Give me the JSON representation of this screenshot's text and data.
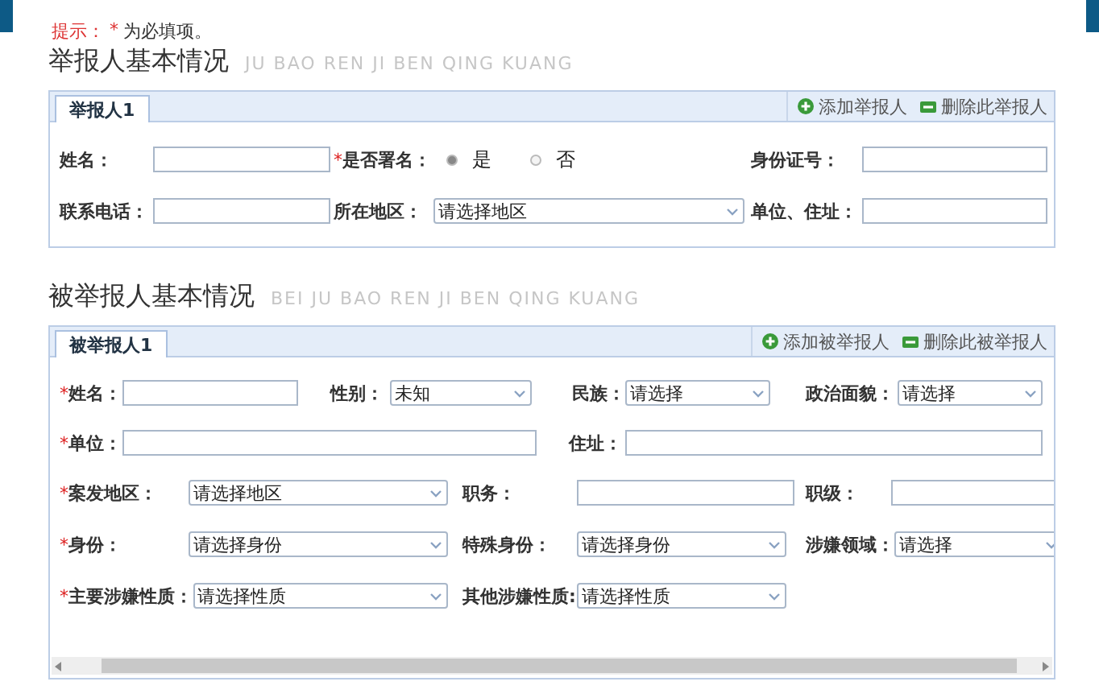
{
  "hint": {
    "label": "提示：",
    "mark": "*",
    "text": "为必填项。"
  },
  "sections": [
    {
      "title": "举报人基本情况",
      "pinyin": "JU BAO REN JI BEN QING KUANG",
      "tab": {
        "label": "举报人1",
        "selected": true
      },
      "actions": [
        {
          "kind": "add",
          "label": "添加举报人"
        },
        {
          "kind": "remove",
          "label": "删除此举报人"
        }
      ],
      "scrollbar": false,
      "field_lines": [
        [
          {
            "label": "姓名：",
            "required": false,
            "kind": "input"
          },
          {
            "label": "是否署名：",
            "required": true,
            "kind": "radio",
            "options": [
              {
                "label": "是",
                "selected": true
              },
              {
                "label": "否",
                "selected": false
              }
            ]
          },
          {
            "label": "身份证号：",
            "required": false,
            "kind": "input"
          }
        ],
        [
          {
            "label": "联系电话：",
            "required": false,
            "kind": "input"
          },
          {
            "label": "所在地区：",
            "required": false,
            "kind": "select",
            "value": "请选择地区"
          },
          {
            "label": "单位、住址：",
            "required": false,
            "kind": "input"
          }
        ]
      ]
    },
    {
      "title": "被举报人基本情况",
      "pinyin": "BEI JU BAO REN JI BEN QING KUANG",
      "tab": {
        "label": "被举报人1",
        "selected": true
      },
      "actions": [
        {
          "kind": "add",
          "label": "添加被举报人"
        },
        {
          "kind": "remove",
          "label": "删除此被举报人"
        }
      ],
      "scrollbar": true,
      "field_lines": [
        [
          {
            "label": "姓名：",
            "required": true,
            "kind": "input"
          },
          {
            "label": "性别：",
            "required": false,
            "kind": "select",
            "value": "未知"
          },
          {
            "label": "民族：",
            "required": false,
            "kind": "select",
            "value": "请选择"
          },
          {
            "label": "政治面貌：",
            "required": false,
            "kind": "select",
            "value": "请选择"
          }
        ],
        [
          {
            "label": "单位：",
            "required": true,
            "kind": "input"
          },
          {
            "label": "住址：",
            "required": false,
            "kind": "input"
          }
        ],
        [
          {
            "label": "案发地区：",
            "required": true,
            "kind": "select",
            "value": "请选择地区"
          },
          {
            "label": "职务：",
            "required": false,
            "kind": "input"
          },
          {
            "label": "职级：",
            "required": false,
            "kind": "input"
          }
        ],
        [
          {
            "label": "身份：",
            "required": true,
            "kind": "select",
            "value": "请选择身份"
          },
          {
            "label": "特殊身份：",
            "required": false,
            "kind": "select",
            "value": "请选择身份"
          },
          {
            "label": "涉嫌领域：",
            "required": false,
            "kind": "select",
            "value": "请选择"
          }
        ],
        [
          {
            "label": "主要涉嫌性质：",
            "required": true,
            "kind": "select",
            "value": "请选择性质"
          },
          {
            "label": "其他涉嫌性质:",
            "required": false,
            "kind": "select",
            "value": "请选择性质"
          }
        ]
      ]
    }
  ]
}
